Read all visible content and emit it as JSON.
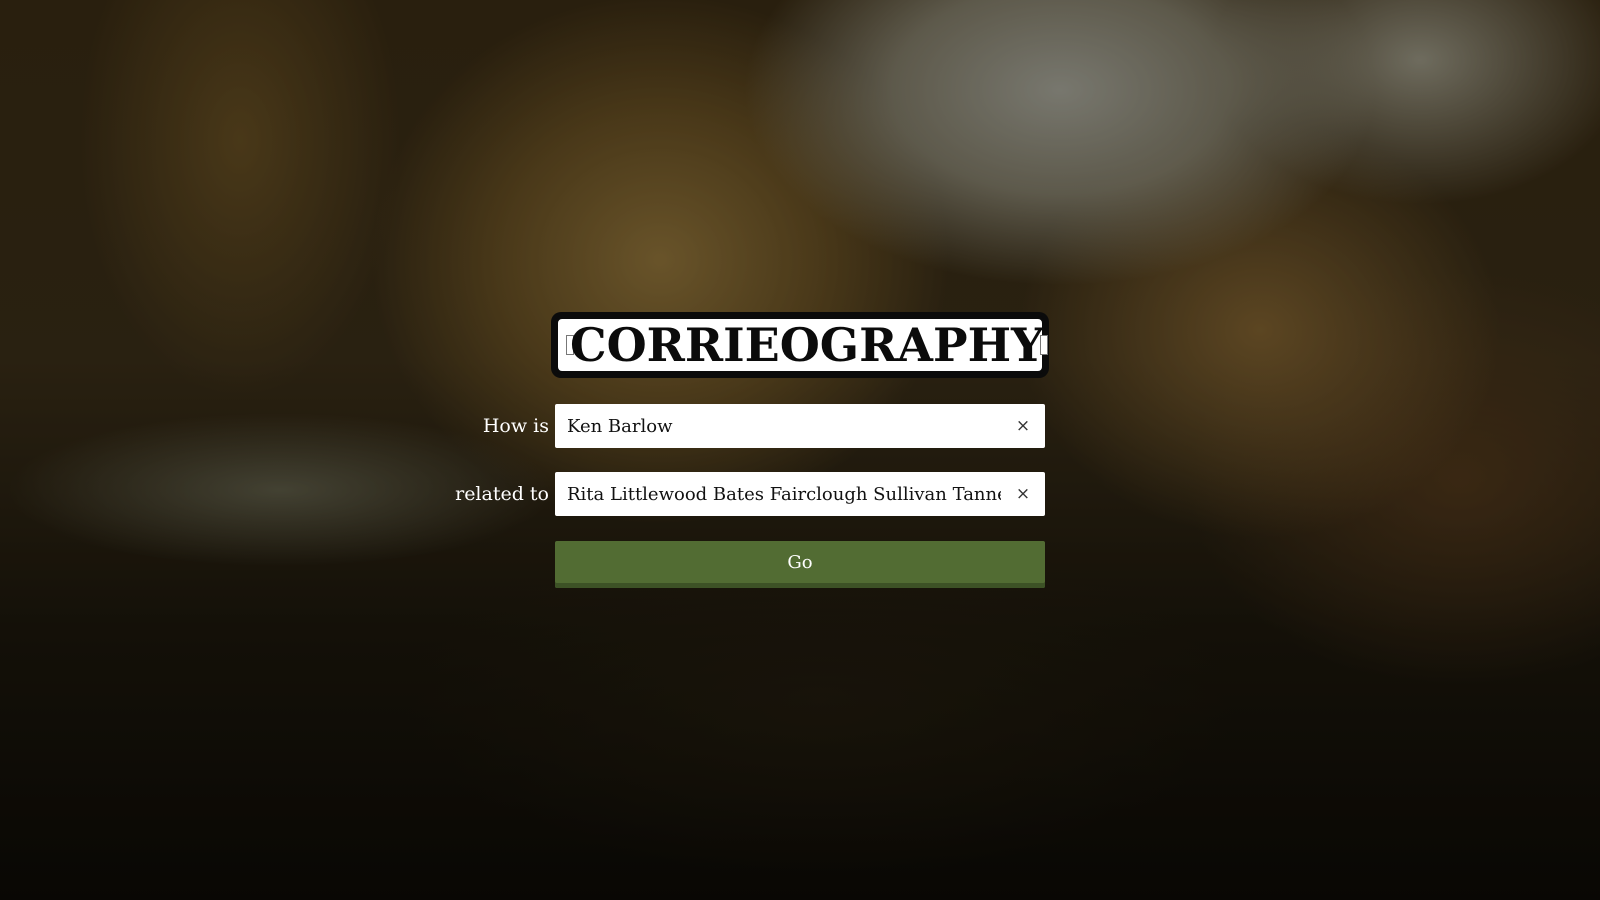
{
  "logo": {
    "text": "CORRIEOGRAPHY"
  },
  "form": {
    "first_label": "How is",
    "first_value": "Ken Barlow",
    "second_label": "related to",
    "second_value": "Rita Littlewood Bates Fairclough Sullivan Tanner",
    "clear_glyph": "×",
    "go_label": "Go"
  },
  "colors": {
    "go_button": "#526c33",
    "input_background": "#ffffff",
    "logo_ink": "#0b0b0b"
  },
  "icons": {
    "clear": "close-icon",
    "logo_ornament": "screw-icon"
  }
}
